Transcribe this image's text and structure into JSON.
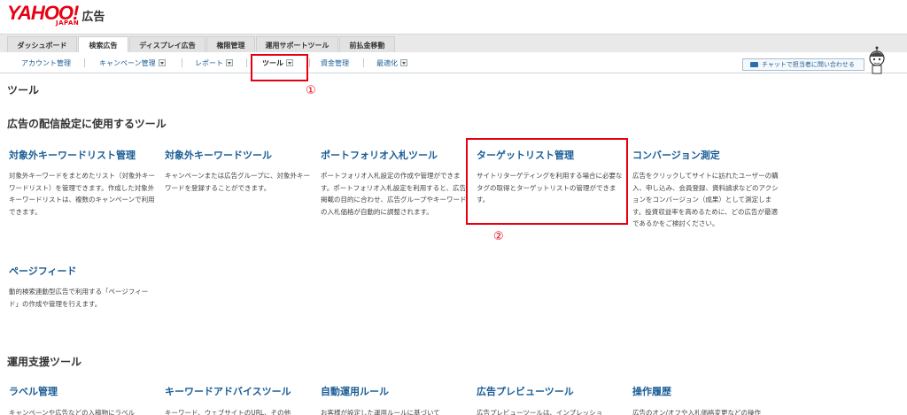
{
  "header": {
    "logo_text": "YAHOO!",
    "logo_sub": "JAPAN",
    "product": "広告"
  },
  "tabs": [
    {
      "label": "ダッシュボード"
    },
    {
      "label": "検索広告",
      "active": true
    },
    {
      "label": "ディスプレイ広告"
    },
    {
      "label": "権限管理"
    },
    {
      "label": "運用サポートツール"
    },
    {
      "label": "前払金移動"
    }
  ],
  "subnav": {
    "account": "アカウント管理",
    "campaign": "キャンペーン管理",
    "report": "レポート",
    "tools": "ツール",
    "funds": "資金管理",
    "optimize": "最適化"
  },
  "chat": {
    "label": "チャットで担当者に問い合わせる"
  },
  "annotations": {
    "one": "①",
    "two": "②"
  },
  "page": {
    "title": "ツール"
  },
  "section1": {
    "title": "広告の配信設定に使用するツール",
    "tools": [
      {
        "name": "対象外キーワードリスト管理",
        "desc": "対象外キーワードをまとめたリスト（対象外キーワードリスト）を管理できます。作成した対象外キーワードリストは、複数のキャンペーンで利用できます。"
      },
      {
        "name": "対象外キーワードツール",
        "desc": "キャンペーンまたは広告グループに、対象外キーワードを登録することができます。"
      },
      {
        "name": "ポートフォリオ入札ツール",
        "desc": "ポートフォリオ入札設定の作成や管理ができます。ポートフォリオ入札設定を利用すると、広告掲載の目的に合わせ、広告グループやキーワードの入札価格が自動的に調整されます。"
      },
      {
        "name": "ターゲットリスト管理",
        "desc": "サイトリターゲティングを利用する場合に必要なタグの取得とターゲットリストの管理ができます。"
      },
      {
        "name": "コンバージョン測定",
        "desc": "広告をクリックしてサイトに訪れたユーザーの購入、申し込み、会員登録、資料請求などのアクションをコンバージョン（成果）として測定します。投資収益率を高めるために、どの広告が最適であるかをご検討ください。"
      },
      {
        "name": "ページフィード",
        "desc": "動的検索連動型広告で利用する「ページフィード」の作成や管理を行えます。"
      }
    ]
  },
  "section2": {
    "title": "運用支援ツール",
    "tools": [
      {
        "name": "ラベル管理",
        "desc": "キャンペーンや広告などの入稿物にラベル"
      },
      {
        "name": "キーワードアドバイスツール",
        "desc": "キーワード、ウェブサイトのURL、その他"
      },
      {
        "name": "自動運用ルール",
        "desc": "お客様が設定した運用ルールに基づいて"
      },
      {
        "name": "広告プレビューツール",
        "desc": "広告プレビューツールは、インプレッショ"
      },
      {
        "name": "操作履歴",
        "desc": "広告のオン/オフや入札価格変更などの操作"
      }
    ]
  },
  "colors": {
    "accent": "#e60012",
    "link": "#1a5d96"
  }
}
